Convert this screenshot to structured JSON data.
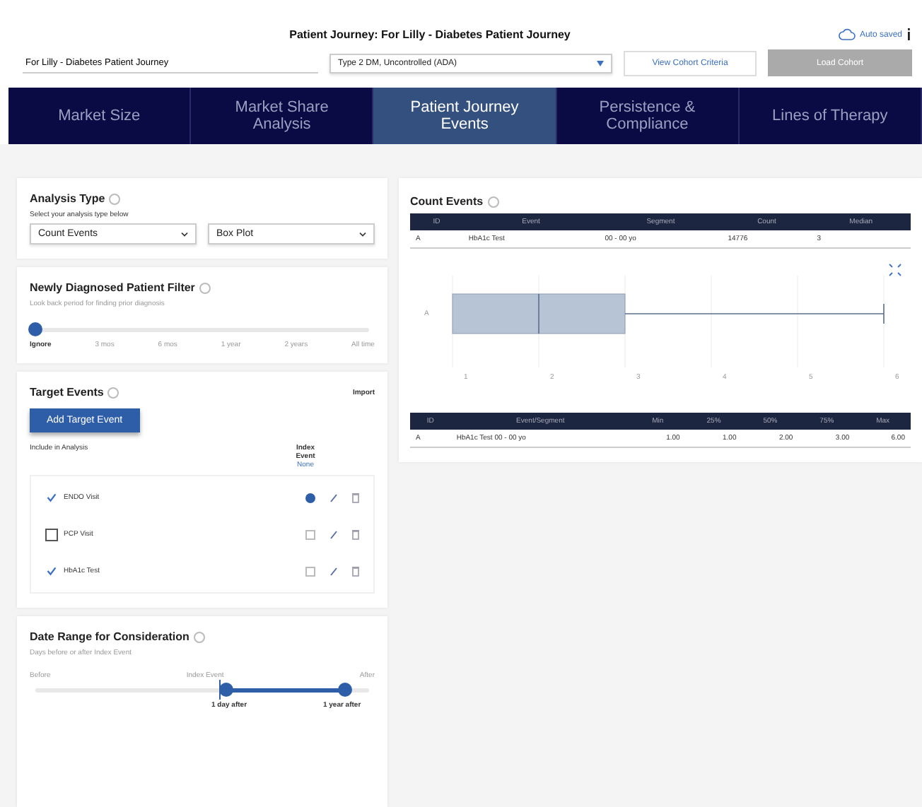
{
  "header": {
    "title": "Patient Journey: For Lilly - Diabetes Patient Journey",
    "autosave": "Auto saved",
    "journey_name": "For Lilly - Diabetes Patient Journey",
    "cohort": "Type 2 DM, Uncontrolled (ADA)",
    "view_criteria": "View Cohort Criteria",
    "load_cohort": "Load Cohort"
  },
  "tabs": [
    {
      "label": "Market Size",
      "selected": false
    },
    {
      "label": "Market Share Analysis",
      "selected": false
    },
    {
      "label": "Patient Journey Events",
      "selected": true
    },
    {
      "label": "Persistence & Compliance",
      "selected": false
    },
    {
      "label": "Lines of Therapy",
      "selected": false
    }
  ],
  "analysis_type": {
    "title": "Analysis Type",
    "hint": "Select your analysis type below",
    "type": "Count Events",
    "view": "Box Plot"
  },
  "newly_diagnosed": {
    "title": "Newly Diagnosed Patient Filter",
    "hint": "Look back period for finding prior diagnosis",
    "level": 0,
    "stops": [
      "Ignore",
      "3 mos",
      "6 mos",
      "1 year",
      "2 years",
      "All time"
    ]
  },
  "target_events": {
    "title": "Target Events",
    "import": "Import",
    "add": "Add Target Event",
    "include_label": "Include in Analysis",
    "index_label": "Index Event",
    "none_label": "None",
    "events": [
      {
        "name": "ENDO Visit",
        "checked": true,
        "index": true
      },
      {
        "name": "PCP Visit",
        "checked": false,
        "index": false
      },
      {
        "name": "HbA1c Test",
        "checked": true,
        "index": false
      }
    ]
  },
  "date_range": {
    "title": "Date Range for Consideration",
    "hint": "Days before or after Index Event",
    "before": "Before",
    "index": "Index Event",
    "after": "After",
    "start": {
      "level": 0.57,
      "label": "1 day after"
    },
    "end": {
      "level": 0.93,
      "label": "1 year after"
    }
  },
  "count_events": {
    "title": "Count Events",
    "table": {
      "columns": [
        "ID",
        "Event",
        "Segment",
        "Count",
        "Median"
      ],
      "rows": [
        [
          "A",
          "HbA1c Test",
          "00 - 00 yo",
          "14776",
          "3"
        ]
      ]
    },
    "box_plot": {
      "category": "A",
      "ticks": [
        "1",
        "2",
        "3",
        "4",
        "5",
        "6"
      ]
    },
    "stats": {
      "columns": [
        "ID",
        "Event/Segment",
        "Min",
        "25%",
        "50%",
        "75%",
        "Max"
      ],
      "rows": [
        [
          "A",
          "HbA1c Test 00 - 00 yo",
          "1.00",
          "1.00",
          "2.00",
          "3.00",
          "6.00"
        ]
      ]
    }
  }
}
